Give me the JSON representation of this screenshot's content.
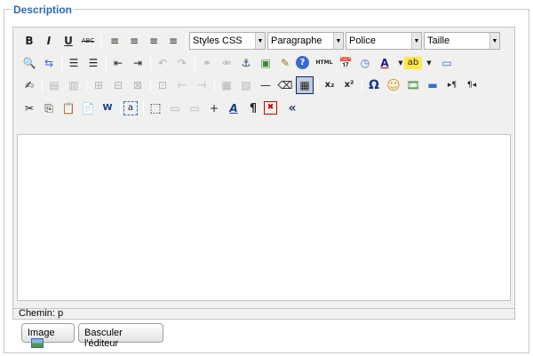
{
  "legend": "Description",
  "toolbar": {
    "row1": {
      "icons": [
        "B",
        "I",
        "U",
        "ABC",
        "≡",
        "≡",
        "≡",
        "≡"
      ],
      "selects": [
        "Styles CSS",
        "Paragraphe",
        "Police",
        "Taille"
      ]
    },
    "row2": [
      "🔍",
      "⇆",
      "☰",
      "☰",
      "⇤",
      "⇥",
      "↶",
      "↷",
      "⚭",
      "⚮",
      "⚓",
      "▣",
      "✎",
      "?",
      "HTML",
      "📅",
      "◷",
      "A",
      "ab",
      "▭"
    ],
    "row3": [
      "✍",
      "▤",
      "▥",
      "⊞",
      "⊟",
      "⊠",
      "⊡",
      "⊢",
      "⊣",
      "▦",
      "▧",
      "—",
      "⌫",
      "▦",
      "x₂",
      "x²",
      "Ω",
      "☺",
      "🎞",
      "▬",
      "▸¶",
      "¶◂"
    ],
    "row4": [
      "✂",
      "⎘",
      "📋",
      "📄",
      "W",
      "a",
      "⬚",
      "▭",
      "▭",
      "+",
      "A",
      "¶",
      "✖",
      "«"
    ]
  },
  "status": "Chemin: p",
  "buttons": {
    "image": "Image",
    "toggle": "Basculer l'éditeur"
  }
}
